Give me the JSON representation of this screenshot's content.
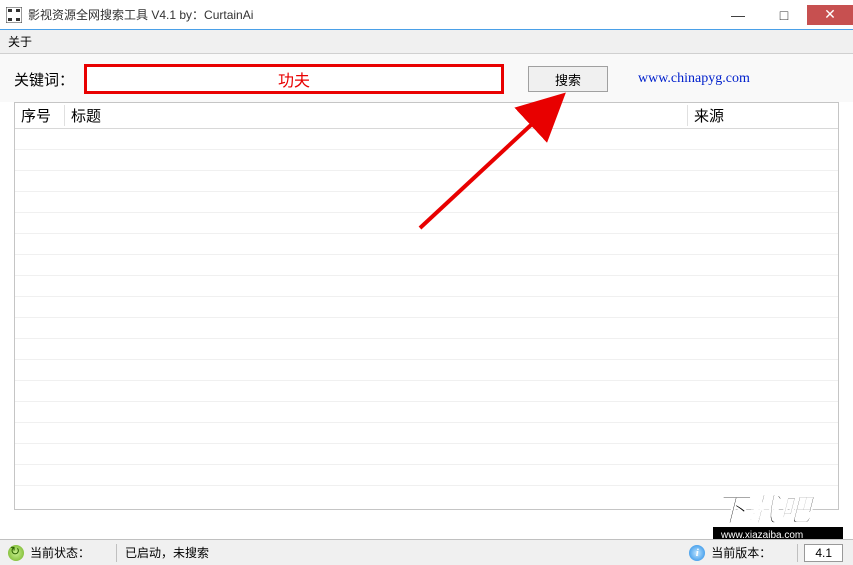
{
  "window": {
    "title": "影视资源全网搜索工具 V4.1 by：CurtainAi"
  },
  "menu": {
    "about": "关于"
  },
  "search": {
    "label": "关键词：",
    "value": "功夫",
    "button": "搜索",
    "link": "www.chinapyg.com"
  },
  "table": {
    "headers": {
      "num": "序号",
      "title": "标题",
      "source": "来源"
    }
  },
  "status": {
    "state_label": "当前状态：",
    "state_value": "已启动，未搜索",
    "ver_label": "当前版本：",
    "ver_value": "4.1"
  },
  "watermark": "下载吧",
  "watermark_url": "www.xiazaiba.com"
}
